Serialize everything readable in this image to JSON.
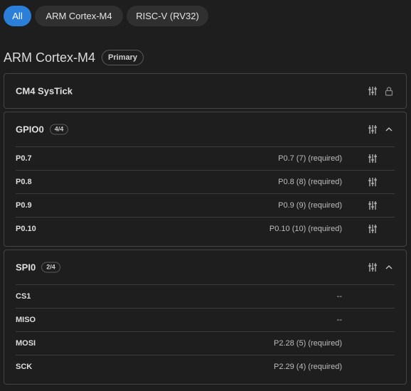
{
  "filter_tabs": [
    {
      "label": "All",
      "active": true
    },
    {
      "label": "ARM Cortex-M4",
      "active": false
    },
    {
      "label": "RISC-V (RV32)",
      "active": false
    }
  ],
  "section": {
    "title": "ARM Cortex-M4",
    "badge": "Primary"
  },
  "peripherals": {
    "systick": {
      "name": "CM4 SysTick",
      "icons": [
        "sliders-icon",
        "lock-icon"
      ]
    },
    "gpio0": {
      "name": "GPIO0",
      "count": "4/4",
      "expanded": true,
      "rows": [
        {
          "pin": "P0.7",
          "value": "P0.7 (7) (required)"
        },
        {
          "pin": "P0.8",
          "value": "P0.8 (8) (required)"
        },
        {
          "pin": "P0.9",
          "value": "P0.9 (9) (required)"
        },
        {
          "pin": "P0.10",
          "value": "P0.10 (10) (required)"
        }
      ]
    },
    "spi0": {
      "name": "SPI0",
      "count": "2/4",
      "expanded": true,
      "rows": [
        {
          "pin": "CS1",
          "value": "--"
        },
        {
          "pin": "MISO",
          "value": "--"
        },
        {
          "pin": "MOSI",
          "value": "P2.28 (5) (required)"
        },
        {
          "pin": "SCK",
          "value": "P2.29 (4) (required)"
        }
      ]
    }
  },
  "colors": {
    "background": "#1e1e1e",
    "accent": "#2b7fd8",
    "border": "#444444",
    "tab_bg": "#303030"
  }
}
